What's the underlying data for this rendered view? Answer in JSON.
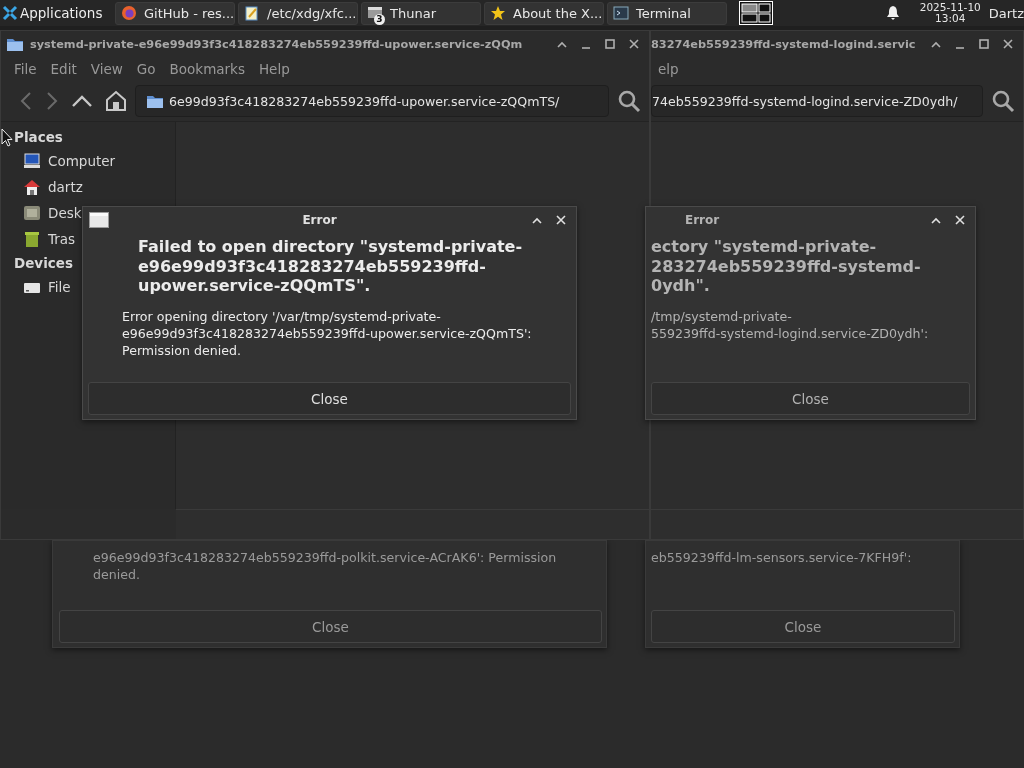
{
  "panel": {
    "apps_menu": "Applications",
    "tasks": [
      {
        "kind": "browser",
        "label": "GitHub - res..."
      },
      {
        "kind": "editor",
        "label": "/etc/xdg/xfc..."
      },
      {
        "kind": "files",
        "label": "Thunar",
        "badge": "3"
      },
      {
        "kind": "star",
        "label": "About the X..."
      },
      {
        "kind": "terminal",
        "label": "Terminal"
      }
    ],
    "clock_date": "2025-11-10",
    "clock_time": "13:04",
    "user": "Dartz"
  },
  "windows": [
    {
      "title": "systemd-private-e96e99d93f3c418283274eb559239ffd-upower.service-zQQm",
      "menu": [
        "File",
        "Edit",
        "View",
        "Go",
        "Bookmarks",
        "Help"
      ],
      "path": "6e99d93f3c418283274eb559239ffd-upower.service-zQQmTS/",
      "sidebar": [
        {
          "title": "Places",
          "items": [
            {
              "kind": "computer",
              "label": "Computer"
            },
            {
              "kind": "home",
              "label": "dartz"
            },
            {
              "kind": "desktop",
              "label": "Desk"
            },
            {
              "kind": "trash",
              "label": "Tras"
            }
          ]
        },
        {
          "title": "Devices",
          "items": [
            {
              "kind": "drive",
              "label": "File"
            }
          ]
        }
      ]
    },
    {
      "title": "83274eb559239ffd-systemd-logind.servic",
      "menu": [
        "elp"
      ],
      "path": "74eb559239ffd-systemd-logind.service-ZD0ydh/"
    }
  ],
  "dialogs": [
    {
      "title": "Error",
      "heading_lines": [
        "Failed to open directory \"systemd-private-",
        "e96e99d93f3c418283274eb559239ffd-",
        "upower.service-zQQmTS\"."
      ],
      "message_lines": [
        "Error opening directory '/var/tmp/systemd-private-",
        "e96e99d93f3c418283274eb559239ffd-upower.service-zQQmTS':",
        "Permission denied."
      ],
      "button": "Close"
    },
    {
      "title": "Error",
      "heading_lines": [
        "ectory \"systemd-private-",
        "283274eb559239ffd-systemd-",
        "0ydh\"."
      ],
      "message_lines": [
        "/tmp/systemd-private-",
        "559239ffd-systemd-logind.service-ZD0ydh':"
      ],
      "button": "Close"
    }
  ],
  "background_dialogs": [
    {
      "message_lines": [
        "e96e99d93f3c418283274eb559239ffd-polkit.service-ACrAK6': Permission",
        "denied."
      ],
      "button": "Close"
    },
    {
      "message_lines": [
        "eb559239ffd-lm-sensors.service-7KFH9f':"
      ],
      "button": "Close"
    }
  ]
}
